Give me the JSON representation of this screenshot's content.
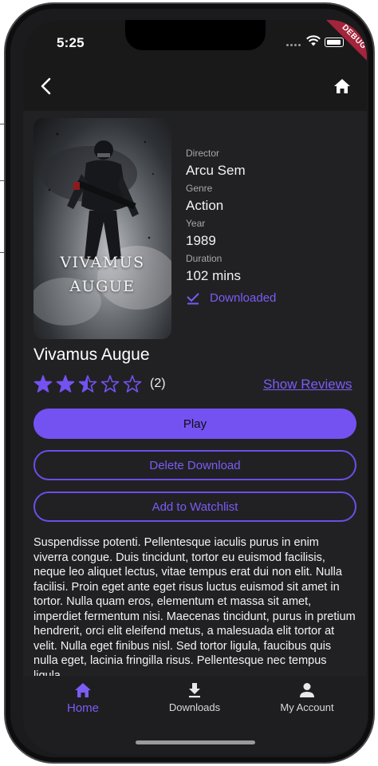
{
  "status_bar": {
    "time": "5:25",
    "debug_label": "DEBUG"
  },
  "app_bar": {
    "back_icon": "chevron-left-icon",
    "home_icon": "home-icon"
  },
  "movie": {
    "poster_title_line1": "VIVAMUS",
    "poster_title_line2": "AUGUE",
    "title": "Vivamus Augue",
    "director_label": "Director",
    "director": "Arcu Sem",
    "genre_label": "Genre",
    "genre": "Action",
    "year_label": "Year",
    "year": "1989",
    "duration_label": "Duration",
    "duration": "102 mins",
    "download_status": "Downloaded",
    "rating": 2.5,
    "rating_max": 5,
    "rating_count": "(2)",
    "show_reviews": "Show Reviews",
    "description": "Suspendisse potenti. Pellentesque iaculis purus in enim viverra congue. Duis tincidunt, tortor eu euismod facilisis, neque leo aliquet lectus, vitae tempus erat dui non elit. Nulla facilisi. Proin eget ante eget risus luctus euismod sit amet in tortor. Nulla quam eros, elementum et massa sit amet, imperdiet fermentum nisi. Maecenas tincidunt, purus in pretium hendrerit, orci elit eleifend metus, a malesuada elit tortor at velit. Nulla eget finibus nisl. Sed tortor ligula, faucibus quis nulla eget, lacinia fringilla risus. Pellentesque nec tempus ligula."
  },
  "actions": {
    "play": "Play",
    "delete_download": "Delete Download",
    "add_to_watchlist": "Add to Watchlist"
  },
  "bottom_nav": {
    "items": [
      {
        "label": "Home",
        "icon": "home-icon",
        "active": true
      },
      {
        "label": "Downloads",
        "icon": "download-icon",
        "active": false
      },
      {
        "label": "My Account",
        "icon": "person-icon",
        "active": false
      }
    ]
  },
  "colors": {
    "accent": "#7452f1",
    "background": "#212124",
    "app_bar": "#19191a",
    "text": "#f2f2f2"
  }
}
